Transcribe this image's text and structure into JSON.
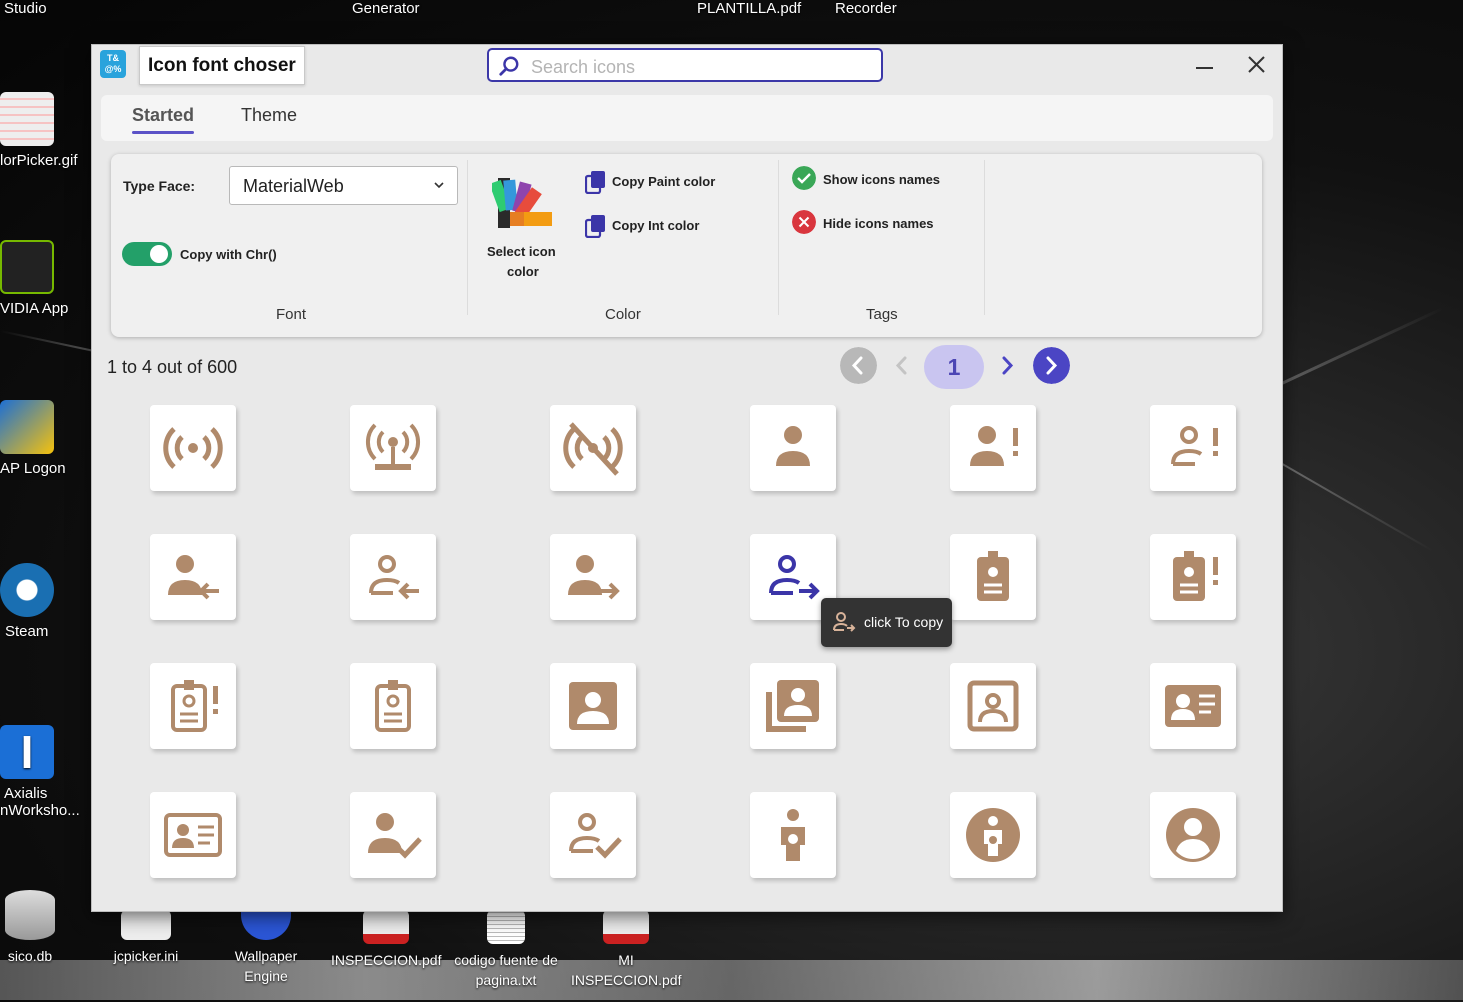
{
  "desktop": {
    "top_labels": [
      "Studio",
      "Generator",
      "PLANTILLA.pdf",
      "Recorder"
    ],
    "left_icons": [
      "lorPicker.gif",
      "VIDIA App",
      "AP Logon",
      "Steam",
      "Axialis",
      "nWorksho..."
    ],
    "bottom_icons": [
      {
        "label": "sico.db"
      },
      {
        "label": "jcpicker.ini"
      },
      {
        "label": "Wallpaper Engine"
      },
      {
        "label": "INSPECCION.pdf"
      },
      {
        "label": "codigo fuente de pagina.txt"
      },
      {
        "label": "MI INSPECCION.pdf"
      }
    ]
  },
  "window": {
    "title": "Icon font choser",
    "search_placeholder": "Search icons",
    "search_value": "",
    "tabs": [
      "Started",
      "Theme"
    ],
    "active_tab": "Started"
  },
  "ribbon": {
    "font": {
      "type_face_label": "Type Face:",
      "type_face_value": "MaterialWeb",
      "copy_with_chr_label": "Copy with Chr()",
      "copy_with_chr_enabled": true,
      "group_label": "Font"
    },
    "color": {
      "select_icon_color_line1": "Select icon",
      "select_icon_color_line2": "color",
      "copy_paint_color": "Copy Paint color",
      "copy_int_color": "Copy Int color",
      "group_label": "Color"
    },
    "tags": {
      "show_icons_names": "Show icons names",
      "hide_icons_names": "Hide icons names",
      "group_label": "Tags"
    }
  },
  "results": {
    "count_text": "1 to 4 out of 600",
    "current_page": "1"
  },
  "icon_color": "#b08a6b",
  "hover_icon_color": "#3b35a8",
  "accent": "#5b52c7",
  "icons": [
    "wifi-tethering-icon",
    "cell-tower-icon",
    "wifi-tethering-off-icon",
    "person-icon",
    "person-alert-icon",
    "person-alert-outline-icon",
    "person-arrow-left-icon",
    "person-arrow-left-outline-icon",
    "person-arrow-right-icon",
    "person-arrow-right-outline-icon",
    "badge-icon",
    "badge-alert-icon",
    "badge-alert-outline-icon",
    "badge-outline-icon",
    "contact-box-icon",
    "contacts-multiple-icon",
    "contact-box-outline-icon",
    "card-account-details-icon",
    "card-account-details-outline-icon",
    "person-check-icon",
    "person-check-outline-icon",
    "person-child-icon",
    "person-child-circle-icon",
    "account-circle-icon"
  ],
  "tooltip": {
    "text": "click To copy"
  }
}
